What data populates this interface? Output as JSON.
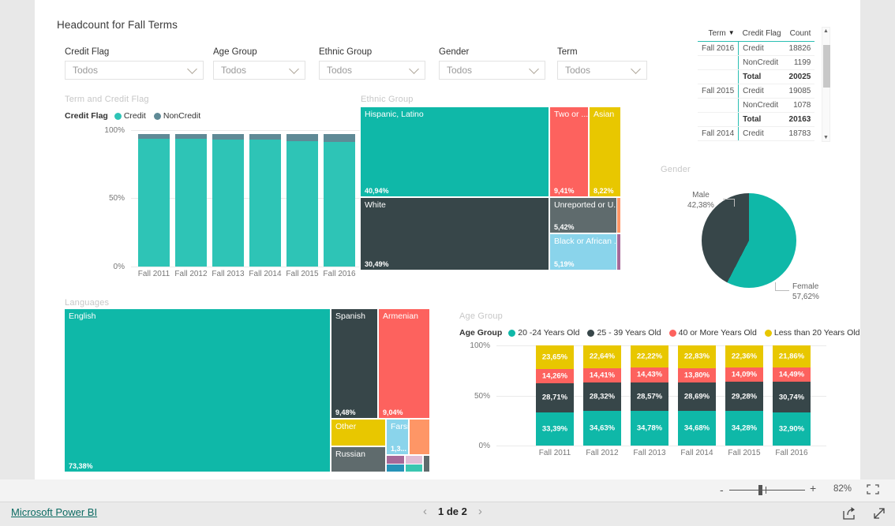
{
  "report": {
    "title": "Headcount for Fall Terms"
  },
  "slicers": [
    {
      "label": "Credit Flag",
      "value": "Todos",
      "icon": "chevron-down-icon"
    },
    {
      "label": "Age Group",
      "value": "Todos",
      "icon": "chevron-down-icon"
    },
    {
      "label": "Ethnic Group",
      "value": "Todos",
      "icon": "chevron-down-icon"
    },
    {
      "label": "Gender",
      "value": "Todos",
      "icon": "chevron-down-icon"
    },
    {
      "label": "Term",
      "value": "Todos",
      "icon": "chevron-down-icon"
    }
  ],
  "visuals": {
    "term_credit_flag": {
      "title": "Term and Credit Flag"
    },
    "ethnic_group": {
      "title": "Ethnic Group"
    },
    "gender": {
      "title": "Gender"
    },
    "languages": {
      "title": "Languages"
    },
    "age_group": {
      "title": "Age Group"
    }
  },
  "table": {
    "columns": [
      "Term",
      "Credit Flag",
      "Count"
    ],
    "sort_column": "Term",
    "sort_icon": "filter-sort-icon",
    "rows": [
      {
        "term": "Fall 2016",
        "flag": "Credit",
        "count": "18826",
        "total": false
      },
      {
        "term": "",
        "flag": "NonCredit",
        "count": "1199",
        "total": false
      },
      {
        "term": "",
        "flag": "Total",
        "count": "20025",
        "total": true
      },
      {
        "term": "Fall 2015",
        "flag": "Credit",
        "count": "19085",
        "total": false
      },
      {
        "term": "",
        "flag": "NonCredit",
        "count": "1078",
        "total": false
      },
      {
        "term": "",
        "flag": "Total",
        "count": "20163",
        "total": true
      },
      {
        "term": "Fall 2014",
        "flag": "Credit",
        "count": "18783",
        "total": false
      }
    ]
  },
  "chart_data": [
    {
      "id": "term_credit_flag",
      "type": "bar",
      "stacked": true,
      "normalized": true,
      "title": "Term and Credit Flag",
      "legend_title": "Credit Flag",
      "legend_position": "top",
      "categories": [
        "Fall 2011",
        "Fall 2012",
        "Fall 2013",
        "Fall 2014",
        "Fall 2015",
        "Fall 2016"
      ],
      "series": [
        {
          "name": "Credit",
          "color": "#2EC4B6",
          "values": [
            96.5,
            96.7,
            96.1,
            95.8,
            94.7,
            94.0
          ]
        },
        {
          "name": "NonCredit",
          "color": "#5F8A96",
          "values": [
            3.5,
            3.3,
            3.9,
            4.2,
            5.3,
            6.0
          ]
        }
      ],
      "ylabel": "",
      "xlabel": "",
      "yticks": [
        "0%",
        "50%",
        "100%"
      ],
      "ylim": [
        0,
        100
      ],
      "grid": true
    },
    {
      "id": "ethnic_group",
      "type": "treemap",
      "title": "Ethnic Group",
      "items": [
        {
          "label": "Hispanic, Latino",
          "value": "40,94%",
          "color": "#0FB8A8"
        },
        {
          "label": "White",
          "value": "30,49%",
          "color": "#374649"
        },
        {
          "label": "Two or ...",
          "value": "9,41%",
          "color": "#FD625E"
        },
        {
          "label": "Asian",
          "value": "8,22%",
          "color": "#E8C700"
        },
        {
          "label": "Unreported or U...",
          "value": "5,42%",
          "color": "#5F6B6D"
        },
        {
          "label": "Black or African ...",
          "value": "5,19%",
          "color": "#8AD4EB"
        },
        {
          "label": "",
          "value": "",
          "color": "#FE9666"
        },
        {
          "label": "",
          "value": "",
          "color": "#A66999"
        }
      ]
    },
    {
      "id": "gender",
      "type": "pie",
      "title": "Gender",
      "slices": [
        {
          "label": "Female",
          "value": "57,62%",
          "percent": 57.62,
          "color": "#0FB8A8"
        },
        {
          "label": "Male",
          "value": "42,38%",
          "percent": 42.38,
          "color": "#374649"
        }
      ]
    },
    {
      "id": "languages",
      "type": "treemap",
      "title": "Languages",
      "items": [
        {
          "label": "English",
          "value": "73,38%",
          "color": "#0FB8A8"
        },
        {
          "label": "Spanish",
          "value": "9,48%",
          "color": "#374649"
        },
        {
          "label": "Armenian",
          "value": "9,04%",
          "color": "#FD625E"
        },
        {
          "label": "Other",
          "value": "",
          "color": "#E8C700"
        },
        {
          "label": "Russian",
          "value": "",
          "color": "#5F6B6D"
        },
        {
          "label": "Farsi",
          "value": "1,3...",
          "color": "#8AD4EB"
        },
        {
          "label": "",
          "value": "",
          "color": "#FE9666"
        },
        {
          "label": "",
          "value": "",
          "color": "#A66999"
        },
        {
          "label": "",
          "value": "",
          "color": "#E0BCD5"
        },
        {
          "label": "",
          "value": "",
          "color": "#2693B8"
        },
        {
          "label": "",
          "value": "",
          "color": "#3AC6B0"
        },
        {
          "label": "",
          "value": "",
          "color": "#5F6B6D"
        }
      ]
    },
    {
      "id": "age_group",
      "type": "bar",
      "stacked": true,
      "normalized": true,
      "title": "Age Group",
      "legend_title": "Age Group",
      "legend_position": "top",
      "categories": [
        "Fall 2011",
        "Fall 2012",
        "Fall 2013",
        "Fall 2014",
        "Fall 2015",
        "Fall 2016"
      ],
      "series": [
        {
          "name": "20 -24 Years Old",
          "color": "#0FB8A8",
          "values_text": [
            "33,39%",
            "34,63%",
            "34,78%",
            "34,68%",
            "34,28%",
            "32,90%"
          ],
          "values": [
            33.39,
            34.63,
            34.78,
            34.68,
            34.28,
            32.9
          ]
        },
        {
          "name": "25 - 39 Years Old",
          "color": "#374649",
          "values_text": [
            "28,71%",
            "28,32%",
            "28,57%",
            "28,69%",
            "29,28%",
            "30,74%"
          ],
          "values": [
            28.71,
            28.32,
            28.57,
            28.69,
            29.28,
            30.74
          ]
        },
        {
          "name": "40 or More Years Old",
          "color": "#FD625E",
          "values_text": [
            "14,26%",
            "14,41%",
            "14,43%",
            "13,80%",
            "14,09%",
            "14,49%"
          ],
          "values": [
            14.26,
            14.41,
            14.43,
            13.8,
            14.09,
            14.49
          ]
        },
        {
          "name": "Less than 20 Years Old",
          "color": "#E8C700",
          "values_text": [
            "23,65%",
            "22,64%",
            "22,22%",
            "22,83%",
            "22,36%",
            "21,86%"
          ],
          "values": [
            23.65,
            22.64,
            22.22,
            22.83,
            22.36,
            21.86
          ]
        }
      ],
      "yticks": [
        "0%",
        "50%",
        "100%"
      ],
      "ylim": [
        0,
        100
      ],
      "grid": true
    }
  ],
  "zoom": {
    "minus_label": "-",
    "plus_label": "+",
    "percent": "82%",
    "fit_icon": "fit-to-page-icon"
  },
  "footer": {
    "brand": "Microsoft Power BI",
    "prev_icon": "chevron-left-icon",
    "page_label": "1 de 2",
    "next_icon": "chevron-right-icon",
    "share_icon": "share-icon",
    "fullscreen_icon": "fullscreen-icon"
  }
}
